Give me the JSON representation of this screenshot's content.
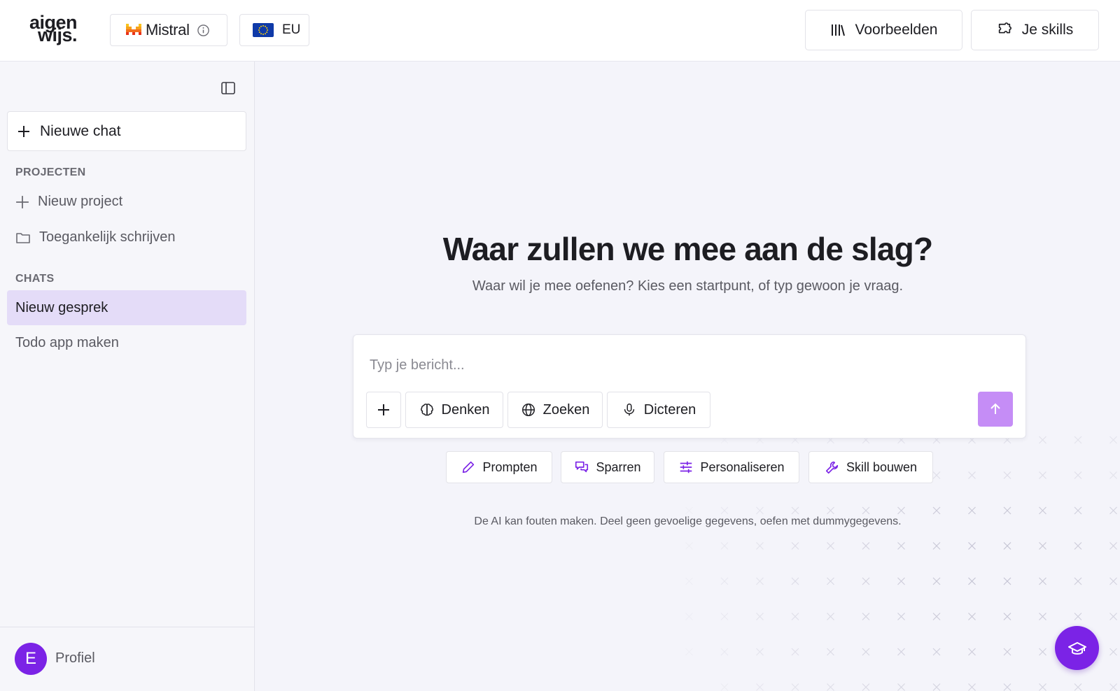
{
  "header": {
    "logo_line1": "aigen",
    "logo_line2": "wijs.",
    "model": {
      "name": "Mistral",
      "logo_icon": "mistral-logo",
      "info_icon": "info-icon"
    },
    "region": {
      "name": "EU",
      "flag_icon": "eu-flag-icon"
    },
    "examples_button": {
      "label": "Voorbeelden",
      "icon": "library-icon"
    },
    "skills_button": {
      "label": "Je skills",
      "icon": "puzzle-icon"
    }
  },
  "sidebar": {
    "collapse_icon": "sidebar-toggle-icon",
    "new_chat": {
      "label": "Nieuwe chat",
      "icon": "plus-icon"
    },
    "projects": {
      "heading": "PROJECTEN",
      "new_project": {
        "label": "Nieuw project",
        "icon": "plus-icon"
      },
      "items": [
        {
          "label": "Toegankelijk schrijven",
          "icon": "folder-icon"
        }
      ]
    },
    "chats": {
      "heading": "CHATS",
      "items": [
        {
          "label": "Nieuw gesprek",
          "active": true
        },
        {
          "label": "Todo app maken",
          "active": false
        }
      ]
    },
    "profile": {
      "initial": "E",
      "label": "Profiel"
    }
  },
  "main": {
    "title": "Waar zullen we mee aan de slag?",
    "subtitle": "Waar wil je mee oefenen? Kies een startpunt, of typ gewoon je vraag.",
    "composer": {
      "placeholder": "Typ je bericht...",
      "tools": [
        {
          "label": "",
          "icon": "plus-icon"
        },
        {
          "label": "Denken",
          "icon": "brain-icon"
        },
        {
          "label": "Zoeken",
          "icon": "globe-icon"
        },
        {
          "label": "Dicteren",
          "icon": "microphone-icon"
        }
      ],
      "send_icon": "arrow-up-icon"
    },
    "chips": [
      {
        "label": "Prompten",
        "icon": "pencil-icon"
      },
      {
        "label": "Sparren",
        "icon": "chat-bubbles-icon"
      },
      {
        "label": "Personaliseren",
        "icon": "sliders-icon"
      },
      {
        "label": "Skill bouwen",
        "icon": "wrench-icon"
      }
    ],
    "disclaimer": "De AI kan fouten maken. Deel geen gevoelige gegevens, oefen met dummygegevens.",
    "help_icon": "graduation-cap-icon"
  },
  "colors": {
    "accent": "#7b23e6",
    "accent_light": "#c58df6",
    "active_chat_bg": "#e4dcf8",
    "chip_icon": "#7b23e6"
  }
}
